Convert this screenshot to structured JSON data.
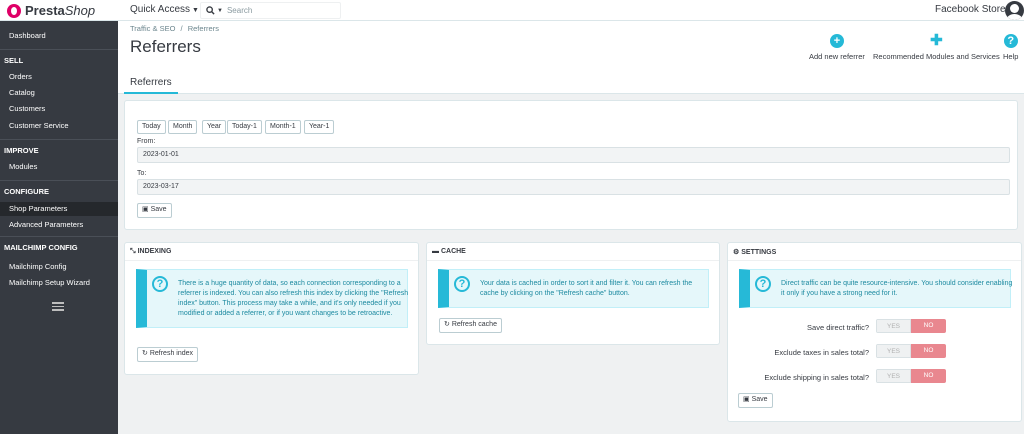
{
  "header": {
    "logo_prefix": "Presta",
    "logo_suffix": "Shop",
    "quick_access": "Quick Access",
    "search_placeholder": "Search",
    "store_name": "Facebook Store"
  },
  "sidebar": {
    "dashboard": "Dashboard",
    "sections": [
      {
        "title": "SELL",
        "items": [
          "Orders",
          "Catalog",
          "Customers",
          "Customer Service"
        ]
      },
      {
        "title": "IMPROVE",
        "items": [
          "Modules"
        ]
      },
      {
        "title": "CONFIGURE",
        "items": [
          "Shop Parameters",
          "Advanced Parameters"
        ]
      },
      {
        "title": "MAILCHIMP CONFIG",
        "items": [
          "Mailchimp Config",
          "Mailchimp Setup Wizard"
        ]
      }
    ],
    "active_item": "Shop Parameters"
  },
  "page": {
    "breadcrumb_parent": "Traffic & SEO",
    "breadcrumb_sep": "/",
    "breadcrumb_current": "Referrers",
    "title": "Referrers",
    "tab": "Referrers",
    "toolbar": {
      "add": "Add new referrer",
      "recommended": "Recommended Modules and Services",
      "help": "Help"
    }
  },
  "date_panel": {
    "ranges": [
      "Today",
      "Month",
      "Year",
      "Today-1",
      "Month-1",
      "Year-1"
    ],
    "from_label": "From:",
    "from_value": "2023-01-01",
    "to_label": "To:",
    "to_value": "2023-03-17",
    "save": "Save"
  },
  "indexing": {
    "title": "INDEXING",
    "message": "There is a huge quantity of data, so each connection corresponding to a referrer is indexed. You can also refresh this index by clicking the \"Refresh index\" button. This process may take a while, and it's only needed if you modified or added a referrer, or if you want changes to be retroactive.",
    "button": "Refresh index"
  },
  "cache": {
    "title": "CACHE",
    "message": "Your data is cached in order to sort it and filter it. You can refresh the cache by clicking on the \"Refresh cache\" button.",
    "button": "Refresh cache"
  },
  "settings": {
    "title": "SETTINGS",
    "message": "Direct traffic can be quite resource-intensive. You should consider enabling it only if you have a strong need for it.",
    "rows": [
      {
        "label": "Save direct traffic?",
        "yes": "YES",
        "no": "NO",
        "value": "NO"
      },
      {
        "label": "Exclude taxes in sales total?",
        "yes": "YES",
        "no": "NO",
        "value": "NO"
      },
      {
        "label": "Exclude shipping in sales total?",
        "yes": "YES",
        "no": "NO",
        "value": "NO"
      }
    ],
    "save": "Save"
  },
  "colors": {
    "accent": "#25b9d7",
    "sidebar": "#363a41",
    "no_active": "#e9878f"
  }
}
